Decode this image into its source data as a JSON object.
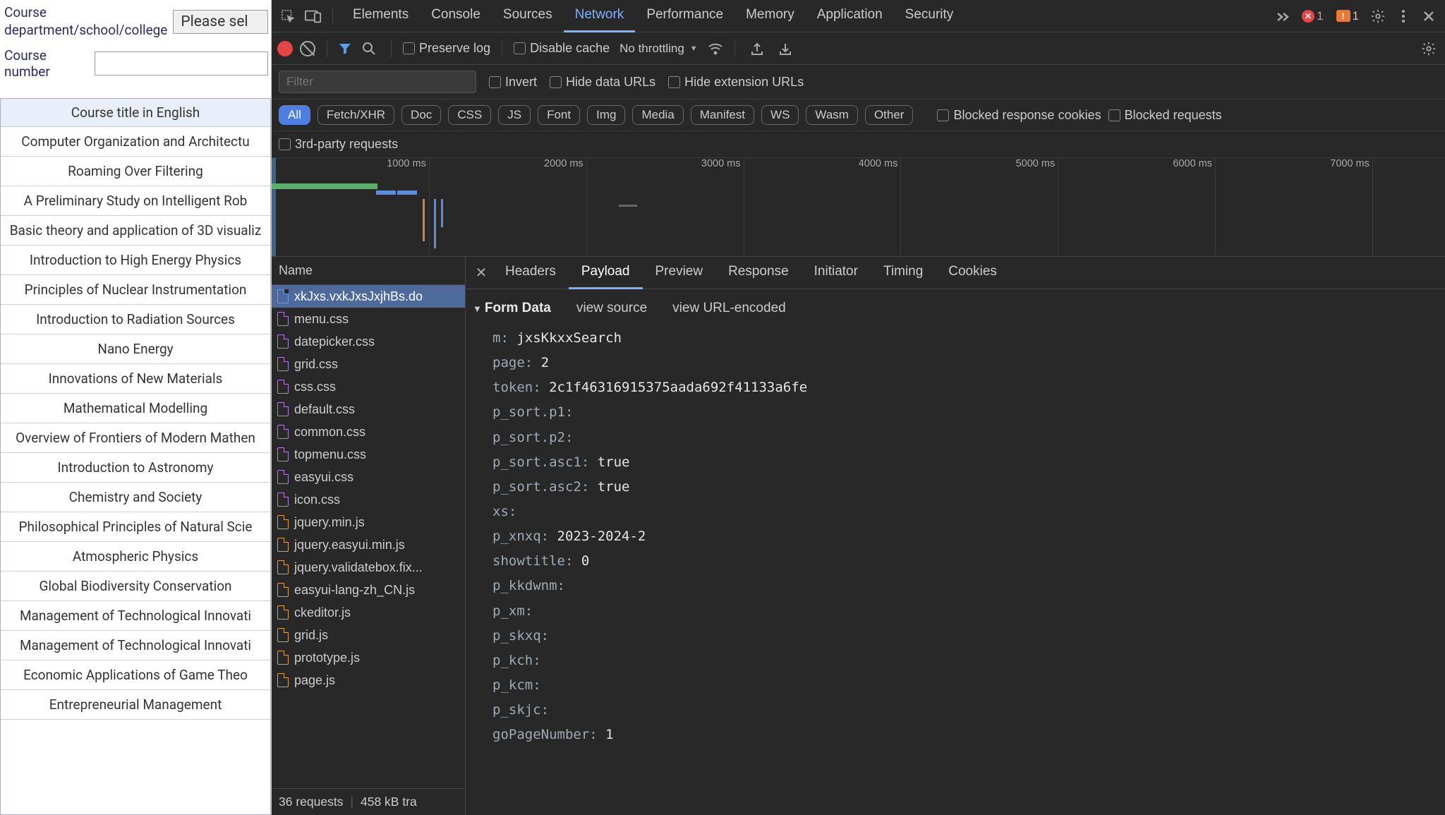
{
  "page": {
    "dept_label_line1": "Course",
    "dept_label_line2": "department/school/college",
    "dept_select_label": "Please sel",
    "number_label": "Course number",
    "number_value": "",
    "table_header": "Course title in English",
    "courses": [
      "Computer Organization and Architectu",
      "Roaming Over Filtering",
      "A Preliminary Study on Intelligent Rob",
      "Basic theory and application of 3D visualiz",
      "Introduction to High Energy Physics",
      "Principles of Nuclear Instrumentation",
      "Introduction to Radiation Sources",
      "Nano Energy",
      "Innovations of New Materials",
      "Mathematical Modelling",
      "Overview of Frontiers of Modern Mathen",
      "Introduction to Astronomy",
      "Chemistry and Society",
      "Philosophical Principles of Natural Scie",
      "Atmospheric Physics",
      "Global Biodiversity Conservation",
      "Management of Technological Innovati",
      "Management of Technological Innovati",
      "Economic Applications of Game Theo",
      "Entrepreneurial Management"
    ]
  },
  "devtools": {
    "tabs": [
      "Elements",
      "Console",
      "Sources",
      "Network",
      "Performance",
      "Memory",
      "Application",
      "Security"
    ],
    "active_tab": "Network",
    "errors_count": "1",
    "issues_count": "1",
    "toolbar": {
      "preserve_log": "Preserve log",
      "disable_cache": "Disable cache",
      "throttling": "No throttling"
    },
    "filter_placeholder": "Filter",
    "invert": "Invert",
    "hide_data": "Hide data URLs",
    "hide_ext": "Hide extension URLs",
    "chips": [
      "All",
      "Fetch/XHR",
      "Doc",
      "CSS",
      "JS",
      "Font",
      "Img",
      "Media",
      "Manifest",
      "WS",
      "Wasm",
      "Other"
    ],
    "blocked_cookies": "Blocked response cookies",
    "blocked_requests": "Blocked requests",
    "third_party": "3rd-party requests",
    "timeline_ticks": [
      {
        "label": "1000 ms",
        "pos": 13.4
      },
      {
        "label": "2000 ms",
        "pos": 26.8
      },
      {
        "label": "3000 ms",
        "pos": 40.2
      },
      {
        "label": "4000 ms",
        "pos": 53.6
      },
      {
        "label": "5000 ms",
        "pos": 67.0
      },
      {
        "label": "6000 ms",
        "pos": 80.4
      },
      {
        "label": "7000 ms",
        "pos": 93.8
      }
    ],
    "name_header": "Name",
    "requests": [
      {
        "name": "xkJxs.vxkJxsJxjhBs.do",
        "type": "blue",
        "selected": true
      },
      {
        "name": "menu.css",
        "type": "purple"
      },
      {
        "name": "datepicker.css",
        "type": "purple"
      },
      {
        "name": "grid.css",
        "type": "purple"
      },
      {
        "name": "css.css",
        "type": "purple"
      },
      {
        "name": "default.css",
        "type": "purple"
      },
      {
        "name": "common.css",
        "type": "purple"
      },
      {
        "name": "topmenu.css",
        "type": "purple"
      },
      {
        "name": "easyui.css",
        "type": "purple"
      },
      {
        "name": "icon.css",
        "type": "purple"
      },
      {
        "name": "jquery.min.js",
        "type": "orange"
      },
      {
        "name": "jquery.easyui.min.js",
        "type": "orange"
      },
      {
        "name": "jquery.validatebox.fix...",
        "type": "orange"
      },
      {
        "name": "easyui-lang-zh_CN.js",
        "type": "orange"
      },
      {
        "name": "ckeditor.js",
        "type": "orange"
      },
      {
        "name": "grid.js",
        "type": "orange"
      },
      {
        "name": "prototype.js",
        "type": "orange"
      },
      {
        "name": "page.js",
        "type": "orange"
      }
    ],
    "status": {
      "requests": "36 requests",
      "transferred": "458 kB tra"
    },
    "detail_tabs": [
      "Headers",
      "Payload",
      "Preview",
      "Response",
      "Initiator",
      "Timing",
      "Cookies"
    ],
    "active_detail_tab": "Payload",
    "form_data_label": "Form Data",
    "view_source": "view source",
    "view_url": "view URL-encoded",
    "form_data": [
      {
        "k": "m:",
        "v": " jxsKkxxSearch"
      },
      {
        "k": "page:",
        "v": " 2"
      },
      {
        "k": "token:",
        "v": " 2c1f46316915375aada692f41133a6fe"
      },
      {
        "k": "p_sort.p1:",
        "v": ""
      },
      {
        "k": "p_sort.p2:",
        "v": ""
      },
      {
        "k": "p_sort.asc1:",
        "v": " true"
      },
      {
        "k": "p_sort.asc2:",
        "v": " true"
      },
      {
        "k": "xs:",
        "v": ""
      },
      {
        "k": "p_xnxq:",
        "v": " 2023-2024-2"
      },
      {
        "k": "showtitle:",
        "v": " 0"
      },
      {
        "k": "p_kkdwnm:",
        "v": ""
      },
      {
        "k": "p_xm:",
        "v": ""
      },
      {
        "k": "p_skxq:",
        "v": ""
      },
      {
        "k": "p_kch:",
        "v": ""
      },
      {
        "k": "p_kcm:",
        "v": ""
      },
      {
        "k": "p_skjc:",
        "v": ""
      },
      {
        "k": "goPageNumber:",
        "v": " 1"
      }
    ]
  }
}
